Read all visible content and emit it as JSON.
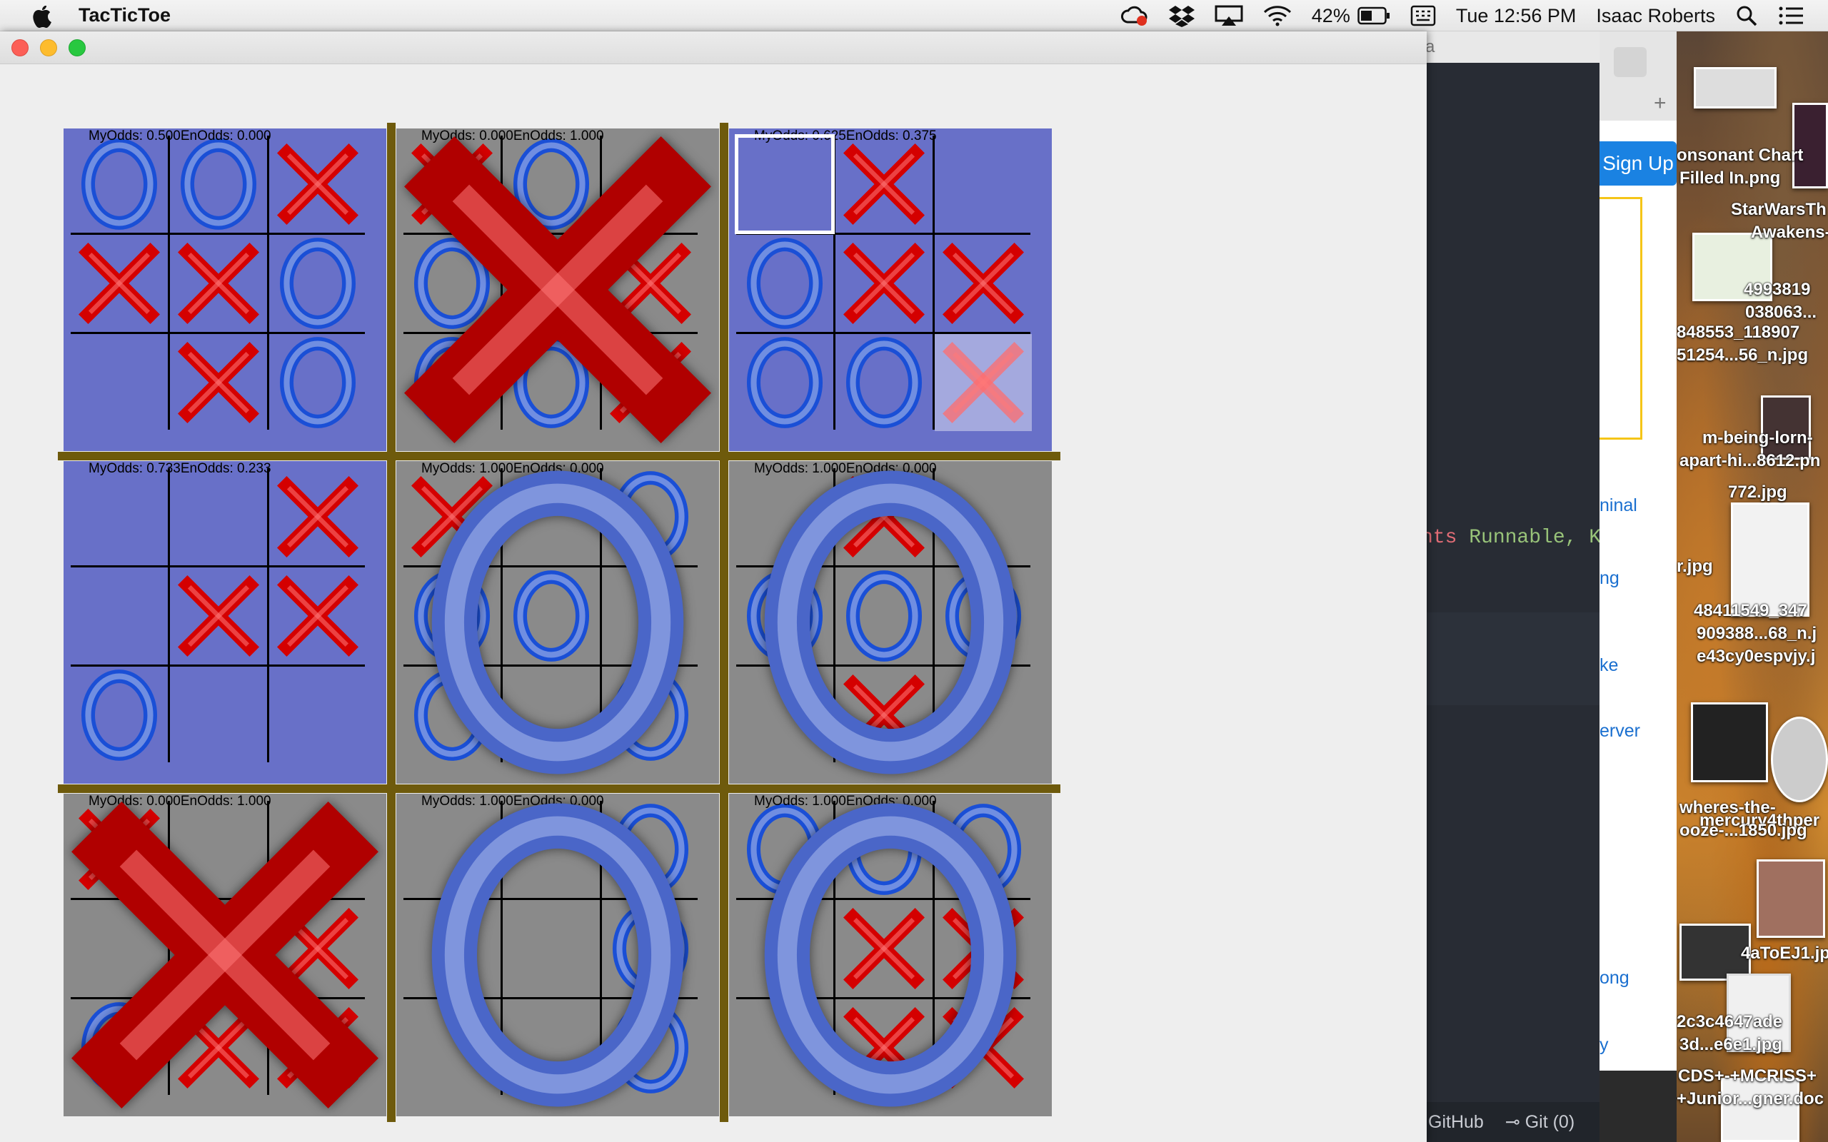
{
  "menubar": {
    "app_name": "TacTicToe",
    "battery_percent": "42%",
    "clock": "Tue 12:56 PM",
    "user_name": "Isaac Roberts",
    "icons": [
      "creative-cloud-icon",
      "dropbox-icon",
      "airplay-icon",
      "wifi-icon",
      "battery-icon",
      "keyboard-icon",
      "search-icon",
      "list-icon"
    ]
  },
  "game": {
    "odds_labels": {
      "my": "MyOdds: ",
      "en": "EnOdds: "
    },
    "colors": {
      "x": "#d40000",
      "o": "#1a4fd6",
      "live_bg": "#6870c8",
      "done_bg": "#8a8a8a",
      "divider": "#6e5a0c"
    },
    "boards": [
      {
        "my_odds": "0.500",
        "en_odds": "0.000",
        "winner": "",
        "cells": [
          "O",
          "O",
          "X",
          "X",
          "X",
          "O",
          "",
          "X",
          "O"
        ]
      },
      {
        "my_odds": "0.000",
        "en_odds": "1.000",
        "winner": "X",
        "cells": [
          "X",
          "O",
          "",
          "O",
          "",
          "X",
          "O",
          "O",
          "X"
        ]
      },
      {
        "my_odds": "0.625",
        "en_odds": "0.375",
        "winner": "",
        "cells": [
          "",
          "X",
          "",
          "O",
          "X",
          "X",
          "O",
          "O",
          "X"
        ],
        "selected_cell": 0,
        "preview_cell": 8
      },
      {
        "my_odds": "0.733",
        "en_odds": "0.233",
        "winner": "",
        "cells": [
          "",
          "",
          "X",
          "",
          "X",
          "X",
          "O",
          "",
          ""
        ]
      },
      {
        "my_odds": "1.000",
        "en_odds": "0.000",
        "winner": "O",
        "cells": [
          "X",
          "",
          "O",
          "O",
          "O",
          "",
          "O",
          "",
          "O"
        ]
      },
      {
        "my_odds": "1.000",
        "en_odds": "0.000",
        "winner": "O",
        "cells": [
          "",
          "X",
          "",
          "O",
          "O",
          "O",
          "",
          "X",
          ""
        ]
      },
      {
        "my_odds": "0.000",
        "en_odds": "1.000",
        "winner": "X",
        "cells": [
          "X",
          "",
          "",
          "",
          "",
          "X",
          "O",
          "X",
          "X"
        ]
      },
      {
        "my_odds": "1.000",
        "en_odds": "0.000",
        "winner": "O",
        "cells": [
          "",
          "",
          "O",
          "",
          "",
          "O",
          "",
          "",
          "O"
        ]
      },
      {
        "my_odds": "1.000",
        "en_odds": "0.000",
        "winner": "O",
        "cells": [
          "O",
          "O",
          "O",
          "",
          "X",
          "X",
          "",
          "X",
          "X"
        ]
      }
    ]
  },
  "background_windows": {
    "browser": {
      "sign_up": "Sign Up",
      "links": [
        "ninal",
        "ng",
        "ke",
        "erver",
        "ong",
        "y"
      ]
    },
    "editor": {
      "code_fragment_a": "nts ",
      "code_fragment_b": "Runnable, K",
      "title_fragment": "a",
      "status_github": "GitHub",
      "status_git": "Git (0)"
    },
    "desktop_labels": [
      "onsonant Chart",
      "Filled In.png",
      "StarWarsTh",
      "Awakens-",
      "4993819",
      "038063...",
      "848553_118907",
      "51254...56_n.jpg",
      "m-being-lorn-",
      "apart-hi...8612.pn",
      "772.jpg",
      "r.jpg",
      "48411549_347",
      "909388...68_n.j",
      "e43cy0espvjy.j",
      "wheres-the-",
      "mercury4thper",
      "ooze-...1850.jpg",
      "4aToEJ1.jp",
      "2c3c4647ade",
      "3d...e6e1.jpg",
      "CDS+-+MCRISS+",
      "+Junior...gner.doc"
    ]
  }
}
